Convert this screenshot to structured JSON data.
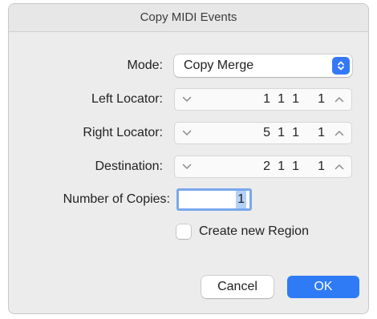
{
  "dialog": {
    "title": "Copy MIDI Events"
  },
  "mode": {
    "label": "Mode:",
    "value": "Copy Merge",
    "icon": "chevron-up-down-icon"
  },
  "left_locator": {
    "label": "Left Locator:",
    "bar": "1",
    "beat": "1",
    "division": "1",
    "tick": "1"
  },
  "right_locator": {
    "label": "Right Locator:",
    "bar": "5",
    "beat": "1",
    "division": "1",
    "tick": "1"
  },
  "destination": {
    "label": "Destination:",
    "bar": "2",
    "beat": "1",
    "division": "1",
    "tick": "1"
  },
  "copies": {
    "label": "Number of Copies:",
    "value": "1"
  },
  "create_region": {
    "label": "Create new Region",
    "checked": false
  },
  "buttons": {
    "cancel": "Cancel",
    "ok": "OK"
  },
  "colors": {
    "accent": "#2f7bf5",
    "focus_ring": "#7aa7ee",
    "dialog_bg": "#ececec"
  }
}
